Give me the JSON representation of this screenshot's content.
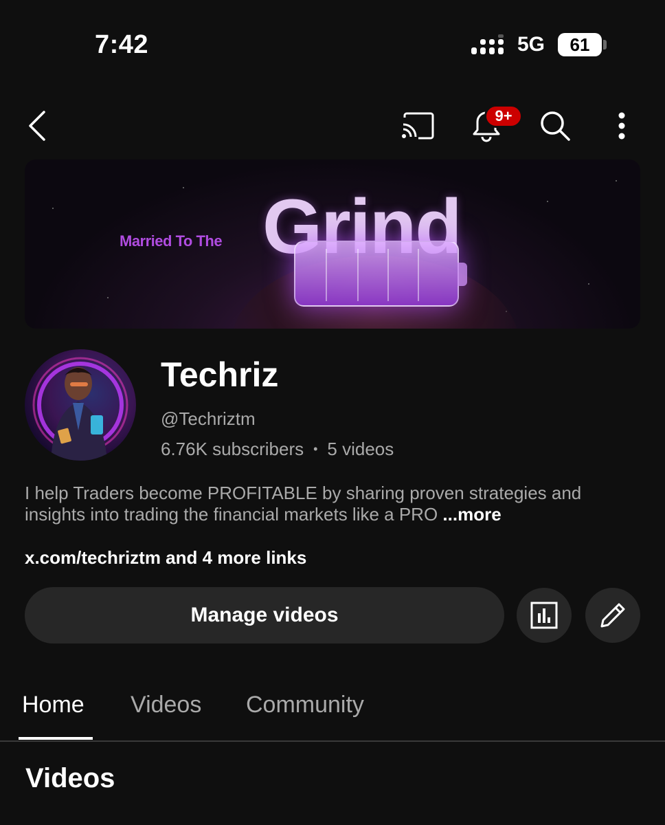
{
  "status_bar": {
    "time": "7:42",
    "network": "5G",
    "battery": "61",
    "signal_icon": "cellular-signal-icon"
  },
  "top_bar": {
    "back_icon": "chevron-left-icon",
    "cast_icon": "cast-icon",
    "notifications_icon": "bell-icon",
    "notifications_badge": "9+",
    "search_icon": "search-icon",
    "more_icon": "more-vertical-icon"
  },
  "banner": {
    "tagline": "Married To The",
    "headline": "Grind"
  },
  "channel": {
    "name": "Techriz",
    "handle": "@Techriztm",
    "subscribers": "6.76K subscribers",
    "separator": "•",
    "videos": "5 videos",
    "description": "I help Traders become PROFITABLE by sharing proven strategies and insights into trading the financial markets like a PRO",
    "more_label": " ...more",
    "links": "x.com/techriztm and 4 more links"
  },
  "actions": {
    "manage_videos_label": "Manage videos",
    "analytics_icon": "analytics-chart-icon",
    "edit_icon": "pencil-icon"
  },
  "tabs": [
    {
      "label": "Home",
      "active": true
    },
    {
      "label": "Videos",
      "active": false
    },
    {
      "label": "Community",
      "active": false
    }
  ],
  "section": {
    "title": "Videos"
  },
  "colors": {
    "background": "#0f0f0f",
    "surface": "#272727",
    "badge": "#cc0000",
    "secondary_text": "#aaaaaa",
    "banner_accent": "#b04ce0"
  }
}
